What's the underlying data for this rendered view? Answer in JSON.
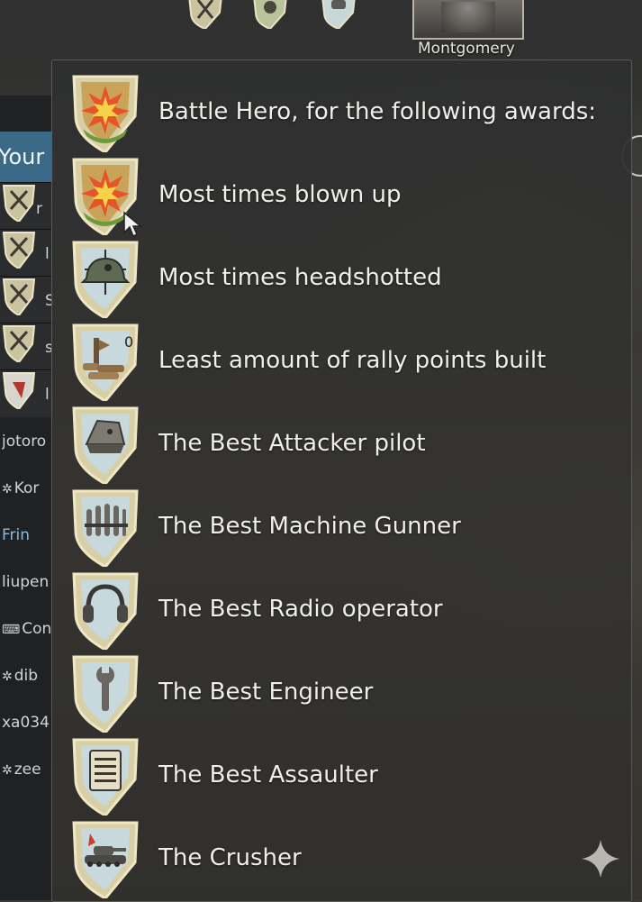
{
  "profile": {
    "name": "Montgomery"
  },
  "left_panel": {
    "header": "Your",
    "rows": [
      {
        "text": "r"
      },
      {
        "text": "l"
      },
      {
        "text": "S"
      },
      {
        "text": "s"
      },
      {
        "text": "l"
      }
    ],
    "players": [
      {
        "name": "jotoro",
        "icon": ""
      },
      {
        "name": "Kor",
        "icon": "✲"
      },
      {
        "name": "Frin",
        "icon": ""
      },
      {
        "name": "liupen",
        "icon": ""
      },
      {
        "name": "Con",
        "icon": "⌨"
      },
      {
        "name": "dib",
        "icon": "✲"
      },
      {
        "name": "xa034",
        "icon": ""
      },
      {
        "name": "zee",
        "icon": "✲"
      }
    ]
  },
  "tooltip": {
    "awards": [
      {
        "label": "Battle Hero, for the following awards:",
        "icon": "explosion-badge-icon"
      },
      {
        "label": "Most times blown up",
        "icon": "explosion-badge-icon"
      },
      {
        "label": "Most times headshotted",
        "icon": "helmet-crosshair-badge-icon"
      },
      {
        "label": "Least amount of rally points built",
        "icon": "rally-point-badge-icon",
        "badge_value": "0"
      },
      {
        "label": "The Best Attacker pilot",
        "icon": "pilot-cap-badge-icon"
      },
      {
        "label": "The Best Machine Gunner",
        "icon": "ammo-belt-badge-icon"
      },
      {
        "label": "The Best Radio operator",
        "icon": "headphones-badge-icon"
      },
      {
        "label": "The Best Engineer",
        "icon": "wrench-badge-icon"
      },
      {
        "label": "The Best Assaulter",
        "icon": "clipboard-badge-icon"
      },
      {
        "label": "The Crusher",
        "icon": "tank-badge-icon"
      }
    ]
  },
  "colors": {
    "panel": "#2f2f2e",
    "badge_rim": "#d9cfa6",
    "badge_inner": "#c8d9dd",
    "hero_badge": "#d9b35c",
    "text": "#f0efea"
  }
}
